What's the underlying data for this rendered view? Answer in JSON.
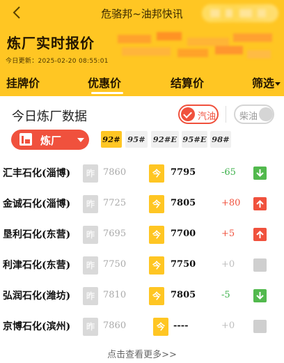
{
  "topbar": {
    "title": "危骆邦~油邦快讯"
  },
  "hero": {
    "title": "炼厂实时报价",
    "update_time": "今日更新：2025-02-20 08:55:01"
  },
  "tabs": [
    {
      "label": "挂牌价",
      "active": false
    },
    {
      "label": "优惠价",
      "active": true
    },
    {
      "label": "结算价",
      "active": false
    },
    {
      "label": "筛选",
      "active": false
    }
  ],
  "section": {
    "title": "今日炼厂数据"
  },
  "fuel_toggle": {
    "gasoline": "汽油",
    "diesel": "柴油",
    "selected": "gasoline"
  },
  "plant_select": {
    "label": "炼厂"
  },
  "grades": [
    {
      "label": "92#",
      "active": true
    },
    {
      "label": "95#",
      "active": false
    },
    {
      "label": "92#E",
      "active": false
    },
    {
      "label": "95#E",
      "active": false
    },
    {
      "label": "98#",
      "active": false
    }
  ],
  "badges": {
    "yesterday": "昨",
    "today": "今"
  },
  "rows": [
    {
      "name": "汇丰石化(淄博)",
      "yesterday": "7860",
      "today": "7795",
      "change": "-65",
      "trend": "down"
    },
    {
      "name": "金诚石化(淄博)",
      "yesterday": "7725",
      "today": "7805",
      "change": "+80",
      "trend": "up"
    },
    {
      "name": "垦利石化(东营)",
      "yesterday": "7695",
      "today": "7700",
      "change": "+5",
      "trend": "up"
    },
    {
      "name": "利津石化(东营)",
      "yesterday": "7750",
      "today": "7750",
      "change": "+0",
      "trend": "flat"
    },
    {
      "name": "弘润石化(潍坊)",
      "yesterday": "7810",
      "today": "7805",
      "change": "-5",
      "trend": "down"
    },
    {
      "name": "京博石化(滨州)",
      "yesterday": "7860",
      "today": "----",
      "change": "+0",
      "trend": "flat"
    }
  ],
  "more": {
    "label": "点击查看更多>>"
  },
  "colors": {
    "brand_yellow": "#ffc623",
    "accent_red": "#f0513d",
    "down_green": "#52b94d",
    "flat_gray": "#cfcfcf"
  }
}
